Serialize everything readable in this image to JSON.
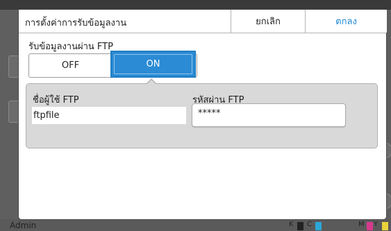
{
  "dialog": {
    "title": "การตั้งค่าการรับข้อมูลงาน",
    "cancel_label": "ยกเลิก",
    "ok_label": "ตกลง"
  },
  "ftp_receive": {
    "label": "รับข้อมูลงานผ่าน FTP",
    "off_label": "OFF",
    "on_label": "ON",
    "selected": "ON"
  },
  "credentials": {
    "username_label": "ชื่อผู้ใช้ FTP",
    "username_value": "ftpfile",
    "password_label": "รหัสผ่าน FTP",
    "password_value": "*****"
  },
  "background": {
    "user": "Admin",
    "ink_labels": [
      "K",
      "C",
      "M",
      "Y"
    ],
    "ink_colors": [
      "#222222",
      "#2aa7d8",
      "#d63a8c",
      "#e9d23a"
    ]
  },
  "colors": {
    "accent": "#2b8bd5",
    "ok_text": "#1b86d3"
  }
}
